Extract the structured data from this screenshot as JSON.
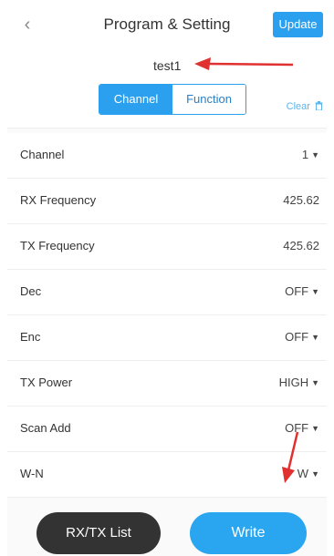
{
  "header": {
    "back_icon": "‹",
    "title": "Program & Setting",
    "update_label": "Update"
  },
  "device": {
    "name": "test1"
  },
  "tabs": [
    {
      "label": "Channel",
      "active": true
    },
    {
      "label": "Function",
      "active": false
    }
  ],
  "clear": {
    "label": "Clear",
    "icon": "trash-icon"
  },
  "rows": [
    {
      "label": "Channel",
      "value": "1",
      "dropdown": true
    },
    {
      "label": "RX Frequency",
      "value": "425.62",
      "dropdown": false
    },
    {
      "label": "TX Frequency",
      "value": "425.62",
      "dropdown": false
    },
    {
      "label": "Dec",
      "value": "OFF",
      "dropdown": true
    },
    {
      "label": "Enc",
      "value": "OFF",
      "dropdown": true
    },
    {
      "label": "TX Power",
      "value": "HIGH",
      "dropdown": true
    },
    {
      "label": "Scan Add",
      "value": "OFF",
      "dropdown": true
    },
    {
      "label": "W-N",
      "value": "W",
      "dropdown": true
    }
  ],
  "footer": {
    "list_label": "RX/TX List",
    "write_label": "Write"
  },
  "colors": {
    "accent": "#2aa0ef",
    "dark_button": "#333333",
    "annotation": "#e03030"
  }
}
